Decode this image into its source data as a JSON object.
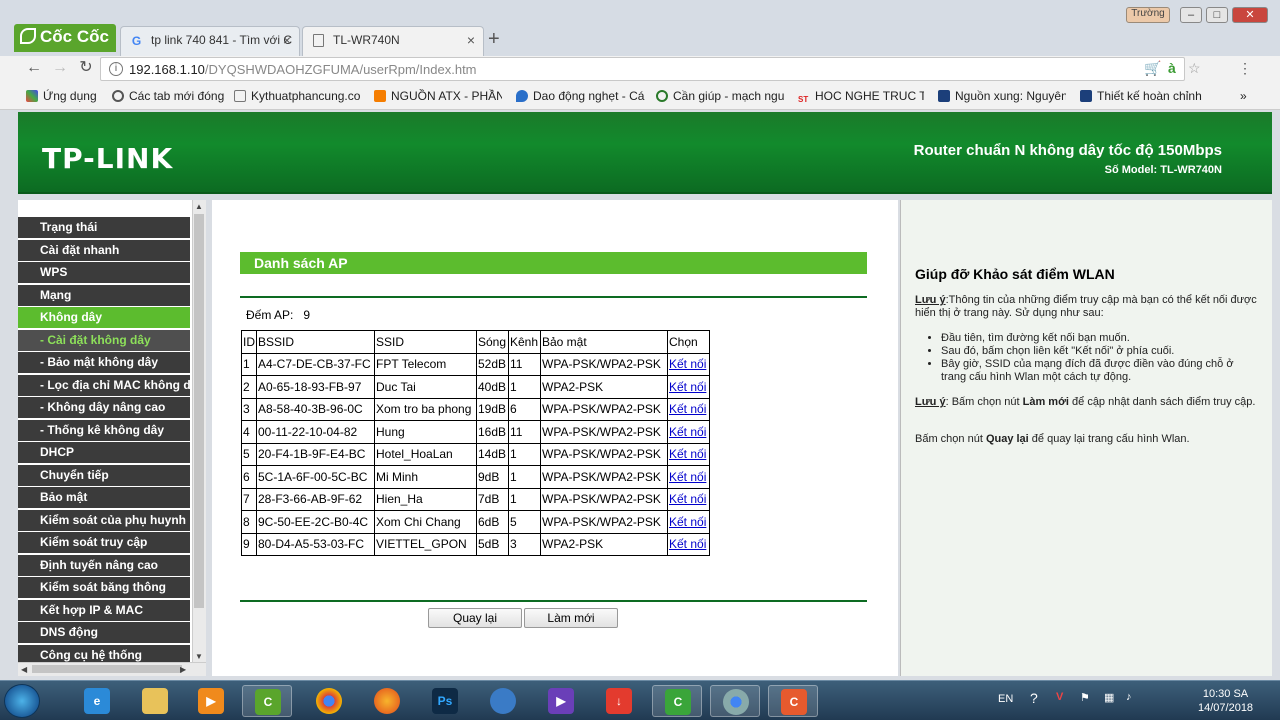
{
  "browser": {
    "brand": "Cốc Cốc",
    "tabs": [
      {
        "title": "tp link 740 841 - Tìm với C",
        "favicon": "G"
      },
      {
        "title": "TL-WR740N",
        "favicon": "document"
      }
    ],
    "window_user": "Trường",
    "url_host": "192.168.1.10",
    "url_path": "/DYQSHWDAOHZGFUMA/userRpm/Index.htm",
    "bookmarks": [
      "Ứng dụng",
      "Các tab mới đóng",
      "Kythuatphancung.co",
      "NGUỒN ATX - PHẦN",
      "Dao động nghẹt - Cá",
      "Cần giúp - mạch ngu",
      "HOC NGHE TRUC TU",
      "Nguồn xung: Nguyên",
      "Thiết kế hoàn chỉnh"
    ],
    "more_bookmarks": "»"
  },
  "router": {
    "logo": "TP-LINK",
    "header_title": "Router chuẩn N không dây tốc độ 150Mbps",
    "header_model": "Số Model: TL-WR740N",
    "menu": [
      {
        "label": "Trạng thái"
      },
      {
        "label": "Cài đặt nhanh"
      },
      {
        "label": "WPS"
      },
      {
        "label": "Mạng"
      },
      {
        "label": "Không dây"
      },
      {
        "label": "- Cài đặt không dây"
      },
      {
        "label": "- Bảo mật không dây"
      },
      {
        "label": "- Lọc địa chỉ MAC không dây"
      },
      {
        "label": "- Không dây nâng cao"
      },
      {
        "label": "- Thống kê không dây"
      },
      {
        "label": "DHCP"
      },
      {
        "label": "Chuyển tiếp"
      },
      {
        "label": "Bảo mật"
      },
      {
        "label": "Kiểm soát của phụ huynh"
      },
      {
        "label": "Kiểm soát truy cập"
      },
      {
        "label": "Định tuyến nâng cao"
      },
      {
        "label": "Kiểm soát băng thông"
      },
      {
        "label": "Kết hợp IP & MAC"
      },
      {
        "label": "DNS động"
      },
      {
        "label": "Công cụ hệ thống"
      }
    ],
    "section_title": "Danh sách AP",
    "ap_count_label": "Đếm AP:",
    "ap_count": "9",
    "table_headers": [
      "ID",
      "BSSID",
      "SSID",
      "Sóng",
      "Kênh",
      "Bảo mật",
      "Chọn"
    ],
    "rows": [
      {
        "id": "1",
        "bssid": "A4-C7-DE-CB-37-FC",
        "ssid": "FPT Telecom",
        "signal": "52dB",
        "channel": "11",
        "security": "WPA-PSK/WPA2-PSK",
        "action": "Kết nối"
      },
      {
        "id": "2",
        "bssid": "A0-65-18-93-FB-97",
        "ssid": "Duc Tai",
        "signal": "40dB",
        "channel": "1",
        "security": "WPA2-PSK",
        "action": "Kết nối"
      },
      {
        "id": "3",
        "bssid": "A8-58-40-3B-96-0C",
        "ssid": "Xom tro ba phong",
        "signal": "19dB",
        "channel": "6",
        "security": "WPA-PSK/WPA2-PSK",
        "action": "Kết nối"
      },
      {
        "id": "4",
        "bssid": "00-11-22-10-04-82",
        "ssid": "Hung",
        "signal": "16dB",
        "channel": "11",
        "security": "WPA-PSK/WPA2-PSK",
        "action": "Kết nối"
      },
      {
        "id": "5",
        "bssid": "20-F4-1B-9F-E4-BC",
        "ssid": "Hotel_HoaLan",
        "signal": "14dB",
        "channel": "1",
        "security": "WPA-PSK/WPA2-PSK",
        "action": "Kết nối"
      },
      {
        "id": "6",
        "bssid": "5C-1A-6F-00-5C-BC",
        "ssid": "Mi Minh",
        "signal": "9dB",
        "channel": "1",
        "security": "WPA-PSK/WPA2-PSK",
        "action": "Kết nối"
      },
      {
        "id": "7",
        "bssid": "28-F3-66-AB-9F-62",
        "ssid": "Hien_Ha",
        "signal": "7dB",
        "channel": "1",
        "security": "WPA-PSK/WPA2-PSK",
        "action": "Kết nối"
      },
      {
        "id": "8",
        "bssid": "9C-50-EE-2C-B0-4C",
        "ssid": "Xom Chi Chang",
        "signal": "6dB",
        "channel": "5",
        "security": "WPA-PSK/WPA2-PSK",
        "action": "Kết nối"
      },
      {
        "id": "9",
        "bssid": "80-D4-A5-53-03-FC",
        "ssid": "VIETTEL_GPON",
        "signal": "5dB",
        "channel": "3",
        "security": "WPA2-PSK",
        "action": "Kết nối"
      }
    ],
    "back_button": "Quay lại",
    "refresh_button": "Làm mới",
    "help": {
      "title": "Giúp đỡ Khảo sát điểm WLAN",
      "note_label": "Lưu ý",
      "note_text": ":Thông tin của những điểm truy cập mà bạn có thể kết nối được hiển thị ở trang này. Sử dụng như sau:",
      "steps": [
        "Đầu tiên, tìm đường kết nối bạn muốn.",
        "Sau đó, bấm chọn liên kết \"Kết nối\" ở phía cuối.",
        "Bây giờ, SSID của mạng đích đã được điền vào đúng chỗ ở trang cấu hình Wlan một cách tự động."
      ],
      "note2_label": "Lưu ý",
      "note2_pre": ": Bấm chọn nút ",
      "note2_bold": "Làm mới",
      "note2_post": " để cập nhật danh sách điểm truy cập.",
      "back_pre": "Bấm chọn nút ",
      "back_bold": "Quay lại",
      "back_post": " để quay lại trang cấu hình Wlan."
    }
  },
  "taskbar": {
    "language": "EN",
    "time": "10:30 SA",
    "date": "14/07/2018"
  },
  "colors": {
    "tplink_green": "#128a2c",
    "menu_active": "#5cbc2e",
    "menu_bg": "#3b3b3b",
    "help_bg": "#f0f4ef"
  }
}
